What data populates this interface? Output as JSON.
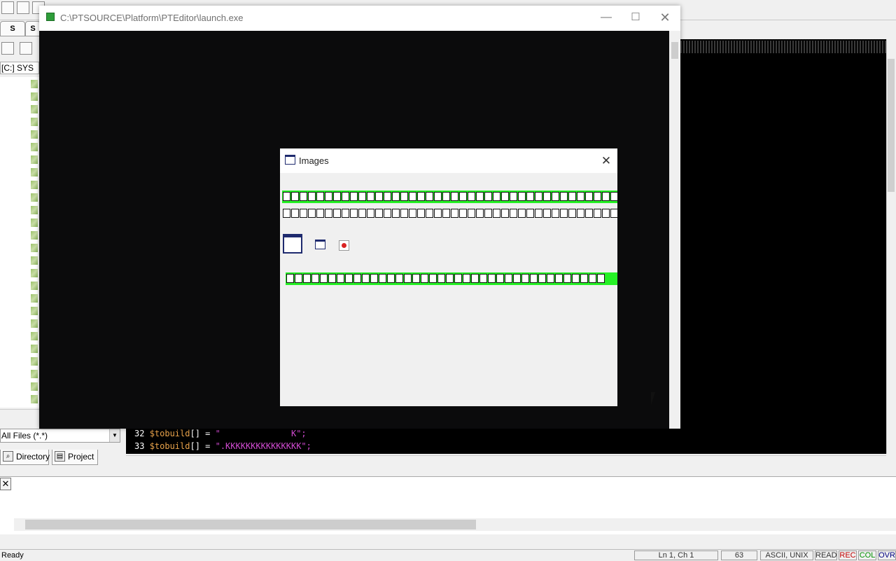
{
  "editor": {
    "side_tabs": [
      "S",
      "S"
    ],
    "drive_label": "[C:] SYS",
    "file_filter": "All Files (*.*)",
    "bottom_tabs": [
      "Directory",
      "Project"
    ],
    "code_lines": [
      {
        "num": "32",
        "var": "$tobuild",
        "op": "[] = ",
        "str": "\"              K\";"
      },
      {
        "num": "33",
        "var": "$tobuild",
        "op": "[] = ",
        "str": "\".KKKKKKKKKKKKKKK\";"
      }
    ],
    "status": {
      "left": "Ready",
      "position": "Ln 1, Ch 1",
      "col_num": "63",
      "encoding": "ASCII, UNIX",
      "read": "READ",
      "rec": "REC",
      "col": "COL",
      "ovr": "OVR"
    },
    "status_colors": {
      "rec": "#c00000",
      "col": "#009000",
      "ovr": "#000080"
    }
  },
  "launch_window": {
    "title": "C:\\PTSOURCE\\Platform\\PTEditor\\launch.exe",
    "controls": {
      "minimize": "—",
      "maximize": "☐",
      "close": "✕"
    }
  },
  "images_dialog": {
    "title": "Images",
    "close": "✕",
    "strip_bg_color": "#26f026"
  }
}
